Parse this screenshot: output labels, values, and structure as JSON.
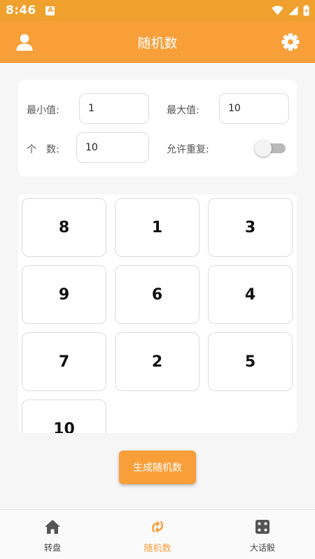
{
  "status_bar": {
    "time": "8:46",
    "app_icon_letter": "A"
  },
  "app_bar": {
    "title": "随机数",
    "left_icon": "user-icon",
    "right_icon": "gear-icon"
  },
  "settings": {
    "min_label": "最小值:",
    "min_value": "1",
    "max_label": "最大值:",
    "max_value": "10",
    "count_label": "个　数:",
    "count_value": "10",
    "repeat_label": "允许重复:",
    "allow_repeat": false
  },
  "results": [
    "8",
    "1",
    "3",
    "9",
    "6",
    "4",
    "7",
    "2",
    "5",
    "10"
  ],
  "generate_label": "生成随机数",
  "bottom_nav": {
    "items": [
      {
        "label": "转盘",
        "icon": "home-icon",
        "active": false
      },
      {
        "label": "随机数",
        "icon": "swap-arrows-icon",
        "active": true
      },
      {
        "label": "大话骰",
        "icon": "dice-icon",
        "active": false
      }
    ]
  },
  "colors": {
    "accent": "#f89f3a",
    "status_bar": "#f0a02c",
    "background": "#f6f6f6"
  }
}
